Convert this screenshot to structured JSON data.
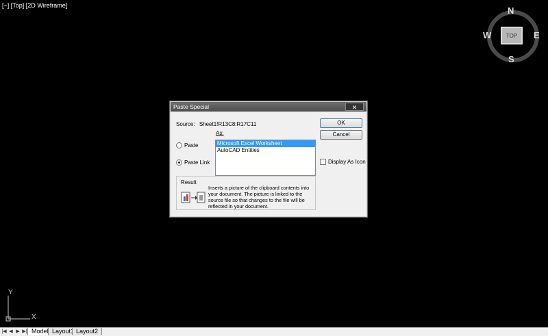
{
  "viewport": {
    "label": "[−] [Top] [2D Wireframe]"
  },
  "viewcube": {
    "face": "TOP",
    "north": "N",
    "south": "S",
    "east": "E",
    "west": "W"
  },
  "ucs": {
    "x": "X",
    "y": "Y"
  },
  "tabs": {
    "nav": [
      "|◀",
      "◀",
      "▶",
      "▶|"
    ],
    "items": [
      "Model",
      "Layout1",
      "Layout2"
    ],
    "active": "Model"
  },
  "dialog": {
    "title": "Paste Special",
    "close": "✕",
    "source_label": "Source:",
    "source_value": "Sheet1!R13C8:R17C11",
    "as_label": "As:",
    "paste_label": "Paste",
    "paste_link_label": "Paste Link",
    "list_items": [
      "Microsoft Excel Worksheet",
      "AutoCAD Entities"
    ],
    "selected_index": 0,
    "ok": "OK",
    "cancel": "Cancel",
    "display_as_icon": "Display As Icon",
    "result_label": "Result",
    "result_text": "Inserts a picture of the clipboard contents into your document.  The picture is linked to the source file so that changes to the file will be reflected in your document."
  }
}
